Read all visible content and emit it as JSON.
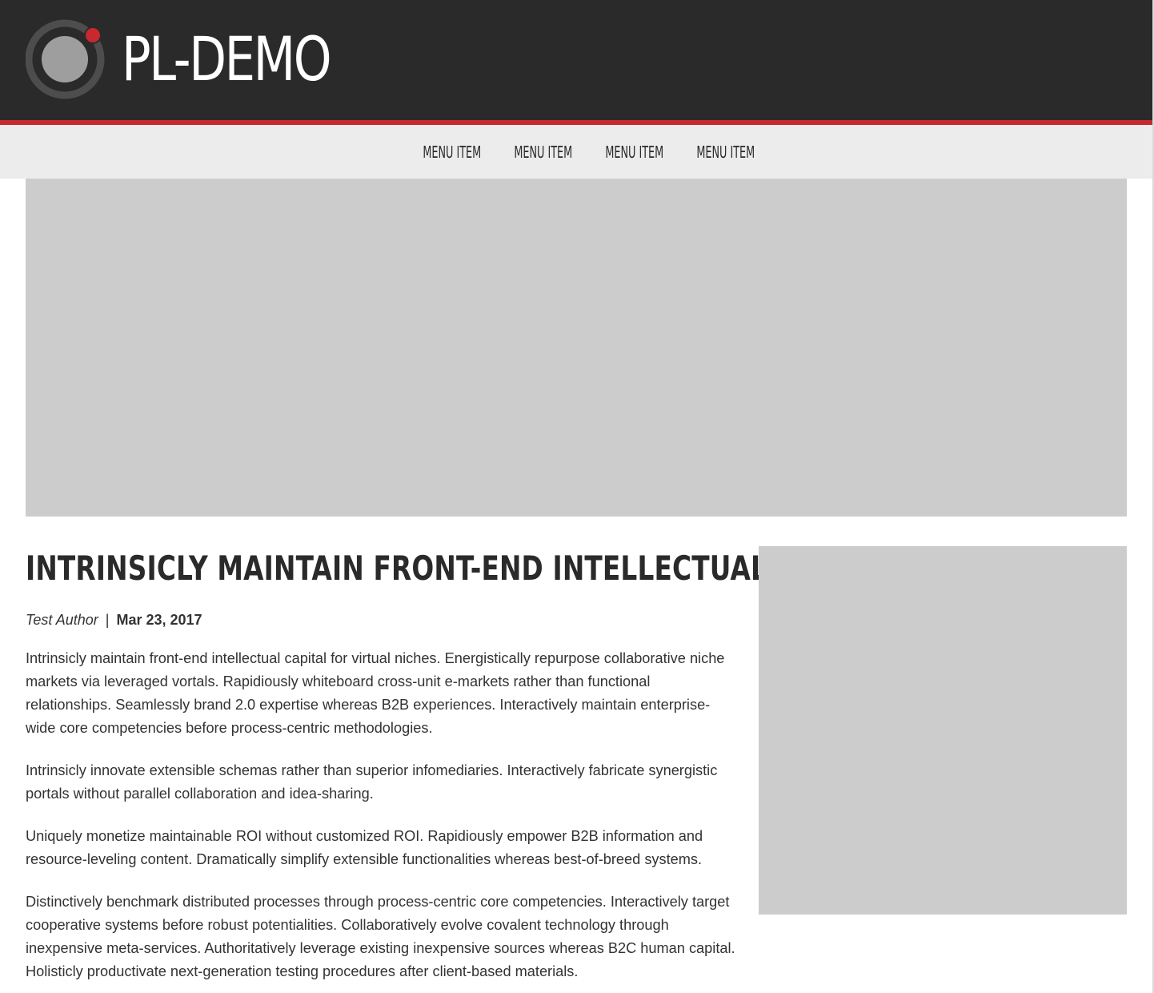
{
  "site": {
    "name": "PL-DEMO",
    "colors": {
      "header_bg": "#2a2a2a",
      "accent": "#c8282e",
      "nav_bg": "#ececec",
      "placeholder": "#cccccc"
    },
    "logo_icon": "record-circle-icon"
  },
  "nav": {
    "items": [
      {
        "label": "MENU ITEM"
      },
      {
        "label": "MENU ITEM"
      },
      {
        "label": "MENU ITEM"
      },
      {
        "label": "MENU ITEM"
      }
    ]
  },
  "article": {
    "title": "INTRINSICLY MAINTAIN FRONT-END INTELLECTUAL",
    "author": "Test Author",
    "separator": "|",
    "date": "Mar 23, 2017",
    "paragraphs": [
      "Intrinsicly maintain front-end intellectual capital for virtual niches. Energistically repurpose collaborative niche markets via leveraged vortals. Rapidiously whiteboard cross-unit e-markets rather than functional relationships. Seamlessly brand 2.0 expertise whereas B2B experiences. Interactively maintain enterprise-wide core competencies before process-centric methodologies.",
      "Intrinsicly innovate extensible schemas rather than superior infomediaries. Interactively fabricate synergistic portals without parallel collaboration and idea-sharing.",
      "Uniquely monetize maintainable ROI without customized ROI. Rapidiously empower B2B information and resource-leveling content. Dramatically simplify extensible functionalities whereas best-of-breed systems.",
      "Distinctively benchmark distributed processes through process-centric core competencies. Interactively target cooperative systems before robust potentialities. Collaboratively evolve covalent technology through inexpensive meta-services. Authoritatively leverage existing inexpensive sources whereas B2C human capital. Holisticly productivate next-generation testing procedures after client-based materials."
    ]
  }
}
